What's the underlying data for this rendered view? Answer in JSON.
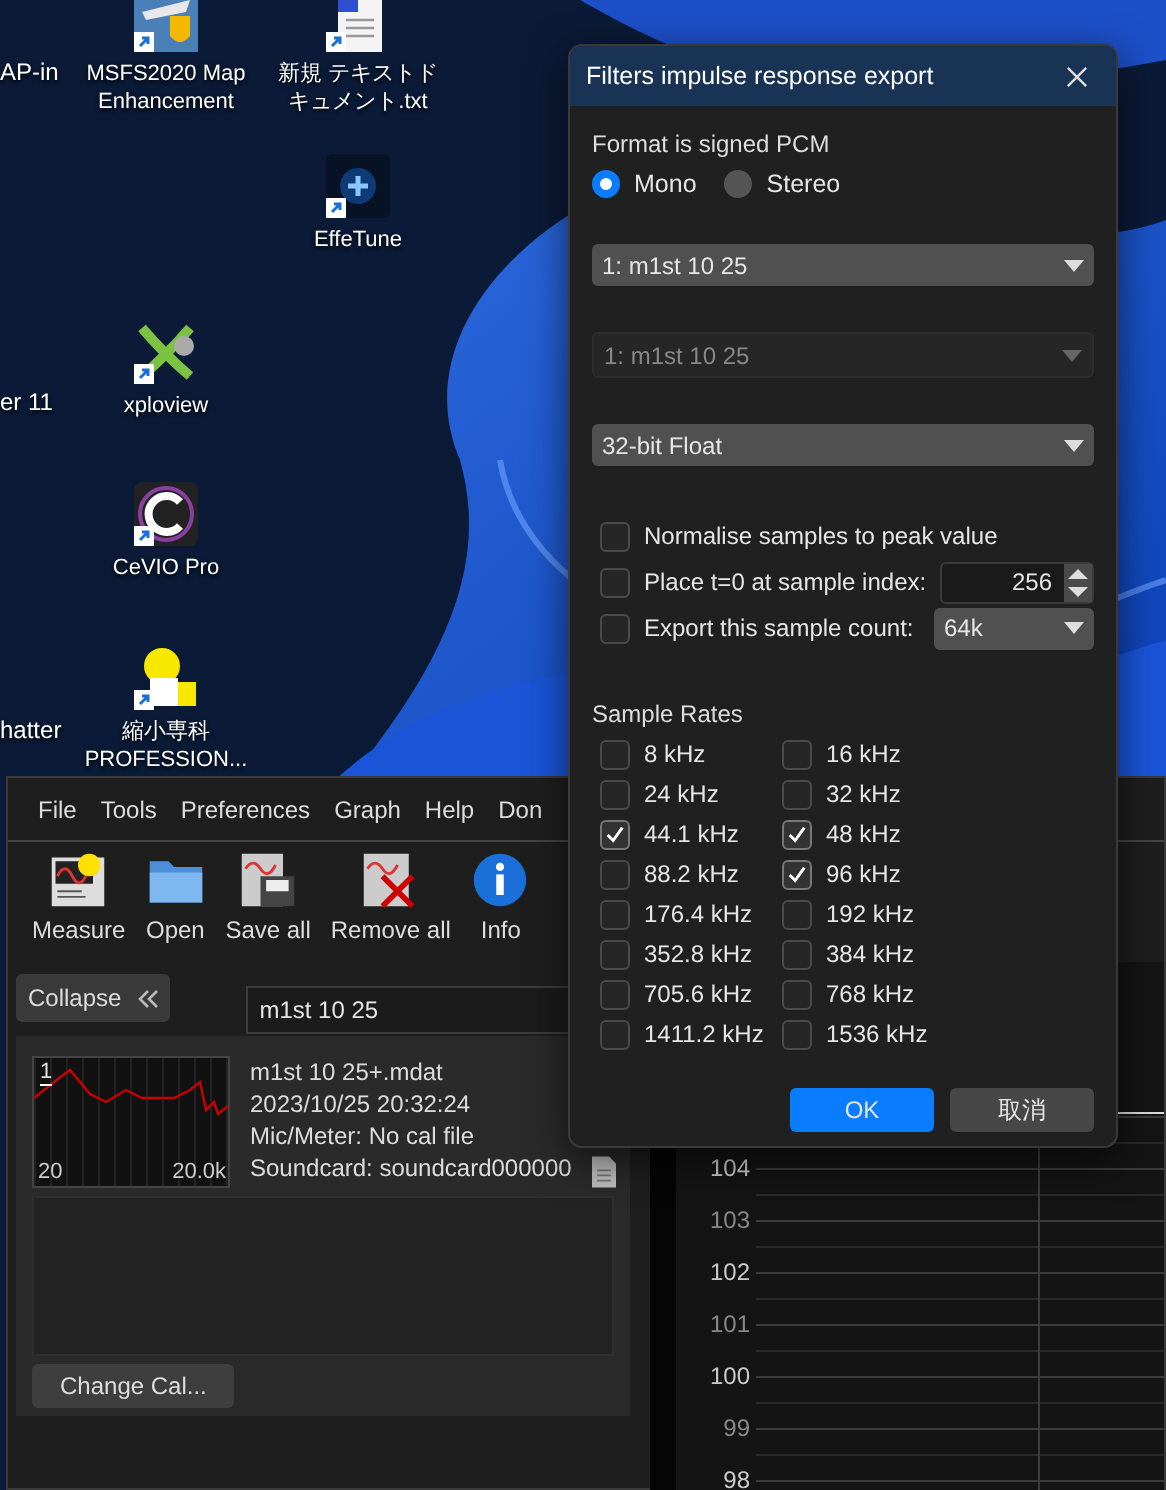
{
  "desktop": {
    "icons": [
      {
        "label": "MSFS2020 Map Enhancement"
      },
      {
        "label": "新規 テキストドキュメント.txt"
      },
      {
        "label": "EffeTune"
      },
      {
        "label": "xploview"
      },
      {
        "label": "CeVIO Pro"
      },
      {
        "label": "縮小専科 PROFESSION..."
      }
    ],
    "cut_labels": [
      "AP-in",
      "er 11",
      "hatter"
    ]
  },
  "rew": {
    "menu": [
      "File",
      "Tools",
      "Preferences",
      "Graph",
      "Help",
      "Don"
    ],
    "toolbar": [
      {
        "label": "Measure"
      },
      {
        "label": "Open"
      },
      {
        "label": "Save all"
      },
      {
        "label": "Remove all"
      },
      {
        "label": "Info"
      }
    ],
    "collapse_button": "Collapse",
    "name_field": "m1st 10 25",
    "measurement": {
      "index": "1",
      "x_min": "20",
      "x_max": "20.0k",
      "lines": [
        "m1st 10 25+.mdat",
        "2023/10/25 20:32:24",
        "Mic/Meter: No cal file",
        "Soundcard: soundcard000000"
      ]
    },
    "change_cal_button": "Change Cal...",
    "graph": {
      "y_labels": [
        "104",
        "103",
        "102",
        "101",
        "100",
        "99",
        "98"
      ]
    }
  },
  "dialog": {
    "title": "Filters impulse response export",
    "format_label": "Format is signed PCM",
    "channels": [
      {
        "label": "Mono",
        "selected": true
      },
      {
        "label": "Stereo",
        "selected": false
      }
    ],
    "dropdowns": [
      {
        "value": "1: m1st 10 25",
        "disabled": false
      },
      {
        "value": "1: m1st 10 25",
        "disabled": true
      },
      {
        "value": "32-bit Float",
        "disabled": false
      }
    ],
    "options": [
      {
        "kind": "check",
        "label": "Normalise samples to peak value",
        "checked": false
      },
      {
        "kind": "spinner",
        "label": "Place t=0 at sample index:",
        "checked": false,
        "value": "256"
      },
      {
        "kind": "combo",
        "label": "Export this sample count:",
        "checked": false,
        "value": "64k"
      }
    ],
    "sample_rates_label": "Sample Rates",
    "sample_rates": [
      {
        "label": "8 kHz",
        "checked": false
      },
      {
        "label": "16 kHz",
        "checked": false
      },
      {
        "label": "24 kHz",
        "checked": false
      },
      {
        "label": "32 kHz",
        "checked": false
      },
      {
        "label": "44.1 kHz",
        "checked": true
      },
      {
        "label": "48 kHz",
        "checked": true
      },
      {
        "label": "88.2 kHz",
        "checked": false
      },
      {
        "label": "96 kHz",
        "checked": true
      },
      {
        "label": "176.4 kHz",
        "checked": false
      },
      {
        "label": "192 kHz",
        "checked": false
      },
      {
        "label": "352.8 kHz",
        "checked": false
      },
      {
        "label": "384 kHz",
        "checked": false
      },
      {
        "label": "705.6 kHz",
        "checked": false
      },
      {
        "label": "768 kHz",
        "checked": false
      },
      {
        "label": "1411.2 kHz",
        "checked": false
      },
      {
        "label": "1536 kHz",
        "checked": false
      }
    ],
    "buttons": [
      {
        "label": "OK",
        "kind": "primary"
      },
      {
        "label": "取消",
        "kind": "secondary"
      }
    ]
  }
}
